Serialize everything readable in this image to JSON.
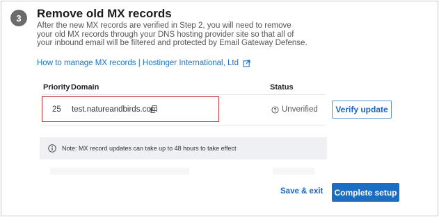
{
  "step": {
    "number": "3",
    "title": "Remove old MX records",
    "description": "After the new MX records are verified in Step 2, you will need to remove your old MX records through your DNS hosting provider site so that all of your inbound email will be filtered and protected by Email Gateway Defense."
  },
  "help_link": {
    "label": "How to manage MX records | Hostinger International, Ltd",
    "icon": "external-link-icon"
  },
  "table": {
    "headers": {
      "priority": "Priority",
      "domain": "Domain",
      "status": "Status"
    },
    "rows": [
      {
        "priority": "25",
        "domain": "test.natureandbirds.com",
        "status": "Unverified",
        "action": "Verify update"
      }
    ]
  },
  "note": {
    "text": "Note: MX record updates can take up to 48 hours to take effect"
  },
  "footer": {
    "save_exit": "Save & exit",
    "complete": "Complete setup"
  },
  "colors": {
    "accent": "#1a6fc4",
    "highlight_border": "#c0343c",
    "badge": "#6b6b6b"
  }
}
